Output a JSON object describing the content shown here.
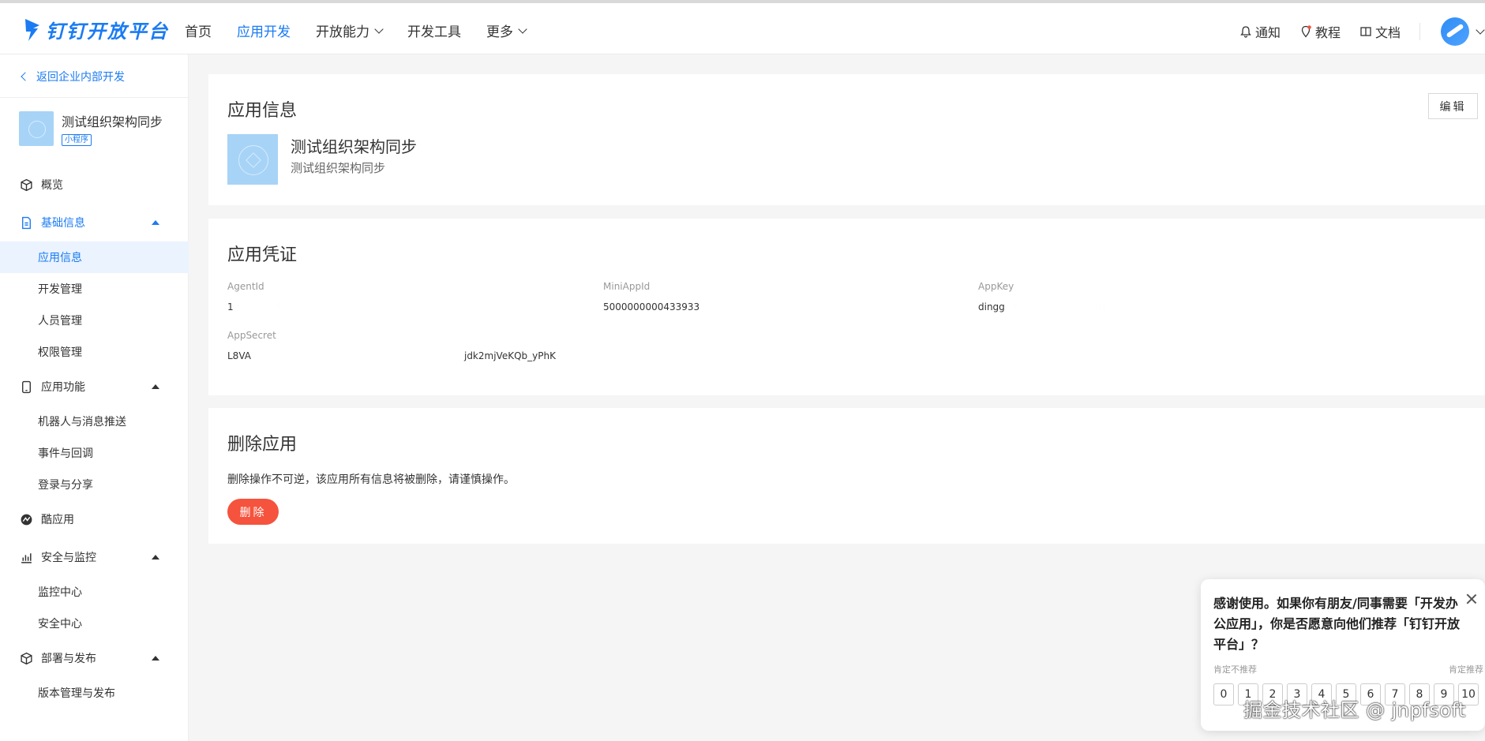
{
  "brand": {
    "name": "钉钉开放平台",
    "color": "#1b7bf2"
  },
  "nav": {
    "items": [
      {
        "label": "首页",
        "active": false,
        "dropdown": false
      },
      {
        "label": "应用开发",
        "active": true,
        "dropdown": false
      },
      {
        "label": "开放能力",
        "active": false,
        "dropdown": true
      },
      {
        "label": "开发工具",
        "active": false,
        "dropdown": false
      },
      {
        "label": "更多",
        "active": false,
        "dropdown": true
      }
    ],
    "tools": {
      "notify": "通知",
      "tutorial": "教程",
      "docs": "文档"
    }
  },
  "sidebar": {
    "back": "返回企业内部开发",
    "app_name": "测试组织架构同步",
    "app_tag": "小程序",
    "menu": {
      "overview": "概览",
      "basic": "基础信息",
      "app_info": "应用信息",
      "dev_mgmt": "开发管理",
      "member_mgmt": "人员管理",
      "permission_mgmt": "权限管理",
      "features": "应用功能",
      "robot": "机器人与消息推送",
      "events": "事件与回调",
      "login_share": "登录与分享",
      "cool_app": "酷应用",
      "security": "安全与监控",
      "monitor": "监控中心",
      "security_center": "安全中心",
      "deploy": "部署与发布",
      "version": "版本管理与发布"
    }
  },
  "app_info": {
    "title": "应用信息",
    "edit": "编辑",
    "name": "测试组织架构同步",
    "desc": "测试组织架构同步"
  },
  "credentials": {
    "title": "应用凭证",
    "agent_id_label": "AgentId",
    "agent_id_value": "1",
    "mini_app_id_label": "MiniAppId",
    "mini_app_id_value": "5000000000433933",
    "app_key_label": "AppKey",
    "app_key_value": "dingg",
    "app_secret_label": "AppSecret",
    "app_secret_prefix": "L8VA",
    "app_secret_suffix": "jdk2mjVeKQb_yPhK"
  },
  "delete_app": {
    "title": "删除应用",
    "warning": "删除操作不可逆，该应用所有信息将被删除，请谨慎操作。",
    "button": "删除",
    "color": "#f5533d"
  },
  "survey": {
    "question": "感谢使用。如果你有朋友/同事需要「开发办公应用」，你是否愿意向他们推荐「钉钉开放平台」？",
    "low_label": "肯定不推荐",
    "high_label": "肯定推荐",
    "scale": [
      "0",
      "1",
      "2",
      "3",
      "4",
      "5",
      "6",
      "7",
      "8",
      "9",
      "10"
    ]
  },
  "watermark": "掘金技术社区 @ jnpfsoft"
}
